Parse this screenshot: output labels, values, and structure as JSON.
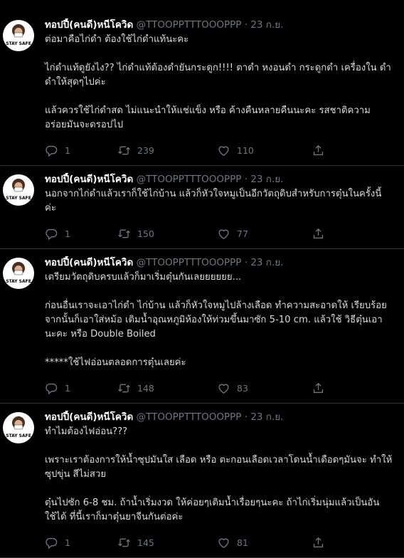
{
  "tweets": [
    {
      "name": "ทอปปี้(คนดี)หนีโควิด",
      "handle": "@TTOOPPTTTOOOPPP",
      "date": "23 ก.ย.",
      "paragraphs": [
        "ต่อมาคือไก่ดำ ต้องใช้ไก่ดำแท้นะคะ",
        "ไก่ดำแท้ดูยังไง?? ไก่ดำแท้ต้องดำยันกระดูก!!!! ตาดำ หงอนดำ กระดูกดำ เครื่องใน ดำ ดำให้สุดๆไปค่ะ",
        "แล้วควรใช้ไก่ดำสด ไม่แนะนำให้แช่แข็ง หรือ ค้างคืนหลายคืนนะคะ รสชาติความ อร่อยมันจะดรอปไป"
      ],
      "replies": "1",
      "retweets": "239",
      "likes": "110"
    },
    {
      "name": "ทอปปี้(คนดี)หนีโควิด",
      "handle": "@TTOOPPTTTOOOPPP",
      "date": "23 ก.ย.",
      "paragraphs": [
        "นอกจากไก่ดำแล้วเราก็ใช้ไก่บ้าน แล้วก็หัวใจหมูเป็นอีกวัตถุดิบสำหรับการตุ๋นในครั้งนี้ ค่ะ"
      ],
      "replies": "1",
      "retweets": "150",
      "likes": "77"
    },
    {
      "name": "ทอปปี้(คนดี)หนีโควิด",
      "handle": "@TTOOPPTTTOOOPPP",
      "date": "23 ก.ย.",
      "paragraphs": [
        "เตรียมวัตถุดิบครบแล้วก็มาเริ่มตุ๋นกันเลยยยยยย...",
        "ก่อนอื่นเราจะเอาไก่ดำ ไก่บ้าน แล้วก็หัวใจหมูไปล้างเลือด ทำความสะอาดให้ เรียบร้อย จากนั้นก็เอาใส่หม้อ เติมน้ำอุณหภูมิห้องให้ท่วมขึ้นมาซัก 5-10 cm. แล้วใช้ วิธีตุ๋นเอานะคะ หรือ Double Boiled",
        "*****ใช้ไฟอ่อนตลอดการตุ๋นเลยค่ะ"
      ],
      "replies": "1",
      "retweets": "148",
      "likes": "83"
    },
    {
      "name": "ทอปปี้(คนดี)หนีโควิด",
      "handle": "@TTOOPPTTTOOOPPP",
      "date": "23 ก.ย.",
      "paragraphs": [
        "ทำไมต้องไฟอ่อน???",
        "เพราะเราต้องการให้น้ำซุปมันใส เลือด หรือ ตะกอนเลือดเวลาโดนน้ำเดือดๆมันจะ ทำให้ซุปขุ่น สีไม่สวย",
        "ตุ๋นไปซัก 6-8 ชม. ถ้าน้ำเริ่มงวด ให้ค่อยๆเติมน้ำเรื่อยๆนะคะ ถ้าไก่เริ่มนุ่มแล้วเป็นอัน ใช้ได้ ที่นี้เราก็มาตุ๋นยาจีนกันต่อค่ะ"
      ],
      "replies": "1",
      "retweets": "145",
      "likes": "81"
    }
  ],
  "avatar_caption": "STAY SAFE",
  "separator": "·",
  "icons": {
    "reply": "reply-icon",
    "retweet": "retweet-icon",
    "like": "heart-icon",
    "share": "share-icon"
  },
  "colors": {
    "background": "#000000",
    "text": "#d9d9d9",
    "name": "#ffffff",
    "muted": "#6e767d",
    "divider": "#2f3336"
  }
}
